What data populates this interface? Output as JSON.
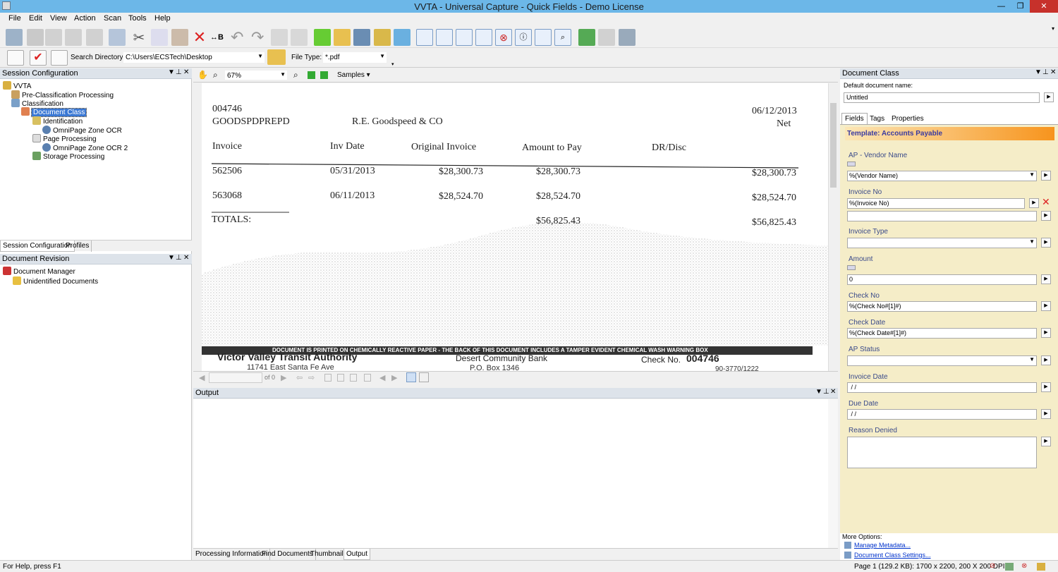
{
  "window": {
    "title": "VVTA - Universal Capture - Quick Fields - Demo License",
    "min": "—",
    "restore": "❐",
    "close": "✕"
  },
  "menu": [
    "File",
    "Edit",
    "View",
    "Action",
    "Scan",
    "Tools",
    "Help"
  ],
  "toolbar2": {
    "search_dir_label": "Search Directory:",
    "search_dir_value": "C:\\Users\\ECSTech\\Desktop",
    "file_type_label": "File Type:",
    "file_type_value": "*.pdf"
  },
  "session_panel": {
    "title": "Session Configuration",
    "tree": [
      "VVTA",
      "Pre-Classification Processing",
      "Classification",
      "Document Class",
      "Identification",
      "OmniPage Zone OCR",
      "Page Processing",
      "OmniPage Zone OCR 2",
      "Storage Processing"
    ],
    "tabs": [
      "Session Configuration",
      "Profiles"
    ]
  },
  "revision_panel": {
    "title": "Document Revision",
    "tree": [
      "Document Manager",
      "Unidentified Documents"
    ]
  },
  "viewer": {
    "zoom": "67%",
    "samples": "Samples",
    "page_of": "of 0"
  },
  "document": {
    "check_no": "004746",
    "payee_code": "GOODSPDPREPD",
    "payee": "R.E. Goodspeed & CO",
    "date": "06/12/2013",
    "terms": "Net",
    "headers": [
      "Invoice",
      "Inv Date",
      "Original Invoice",
      "Amount to Pay",
      "DR/Disc"
    ],
    "rows": [
      [
        "562506",
        "05/31/2013",
        "$28,300.73",
        "$28,300.73",
        "$28,300.73"
      ],
      [
        "563068",
        "06/11/2013",
        "$28,524.70",
        "$28,524.70",
        "$28,524.70"
      ]
    ],
    "totals_label": "TOTALS:",
    "totals_pay": "$56,825.43",
    "totals_net": "$56,825.43",
    "banner": "DOCUMENT IS PRINTED ON CHEMICALLY REACTIVE PAPER - THE BACK OF THIS DOCUMENT INCLUDES A TAMPER EVIDENT CHEMICAL WASH WARNING BOX",
    "org": "Victor Valley Transit Authority",
    "address": "11741 East Santa Fe Ave",
    "bank": "Desert Community Bank",
    "bank_box": "P.O. Box 1346",
    "check_label": "Check No.",
    "check_value": "004746",
    "routing": "90-3770/1222"
  },
  "output_panel": {
    "title": "Output",
    "tabs": [
      "Processing Information",
      "Find Documents",
      "Thumbnails",
      "Output"
    ]
  },
  "docclass_panel": {
    "title": "Document Class",
    "default_name_label": "Default document name:",
    "default_name_value": "Untitled",
    "tabs": [
      "Fields",
      "Tags",
      "Properties"
    ],
    "template": "Template: Accounts Payable",
    "fields": [
      {
        "label": "AP - Vendor Name",
        "value": "%(Vendor Name)"
      },
      {
        "label": "Invoice No",
        "value": "%(Invoice No)"
      },
      {
        "label": "Invoice Type",
        "value": ""
      },
      {
        "label": "Amount",
        "value": "0"
      },
      {
        "label": "Check No",
        "value": "%(Check No#[1]#)"
      },
      {
        "label": "Check Date",
        "value": "%(Check Date#[1]#)"
      },
      {
        "label": "AP Status",
        "value": ""
      },
      {
        "label": "Invoice Date",
        "value": " / /"
      },
      {
        "label": "Due Date",
        "value": " / /"
      },
      {
        "label": "Reason Denied",
        "value": ""
      }
    ],
    "more_options": "More Options:",
    "link1": "Manage Metadata...",
    "link2": "Document Class Settings..."
  },
  "status": {
    "help": "For Help, press F1",
    "page_info": "Page 1 (129.2 KB): 1700 x 2200, 200 X 200 DPI"
  },
  "colors": {
    "accent": "#f7941d",
    "title_bar": "#6cb7e8",
    "panel_bg": "#f5edc8"
  }
}
